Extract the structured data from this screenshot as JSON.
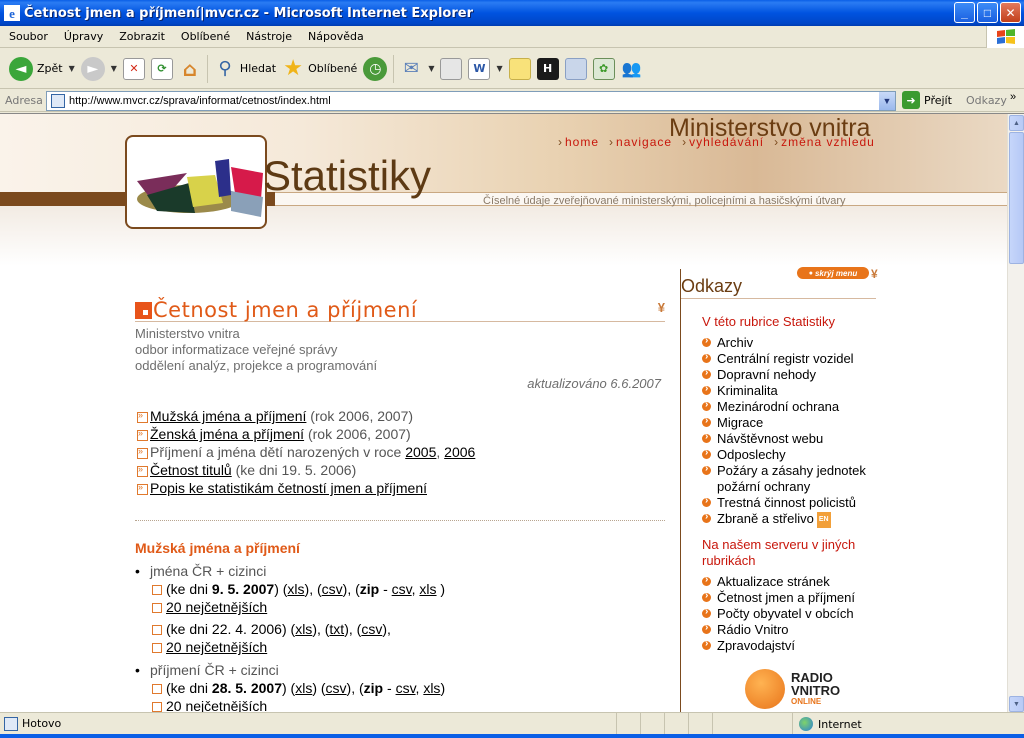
{
  "window": {
    "title": "Četnost jmen a příjmení|mvcr.cz - Microsoft Internet Explorer",
    "minimize": "_",
    "maximize": "□",
    "close": "✕"
  },
  "menu": [
    "Soubor",
    "Úpravy",
    "Zobrazit",
    "Oblíbené",
    "Nástroje",
    "Nápověda"
  ],
  "toolbar": {
    "back_label": "Zpět",
    "search_label": "Hledat",
    "favorites_label": "Oblíbené"
  },
  "address": {
    "label": "Adresa",
    "url": "http://www.mvcr.cz/sprava/informat/cetnost/index.html",
    "go_label": "Přejít",
    "links_label": "Odkazy",
    "more": "»"
  },
  "banner": {
    "ministry": "Ministerstvo vnitra",
    "site_title": "Statistiky",
    "subtitle": "Číselné údaje zveřejňované ministerskými, policejními a hasičskými útvary",
    "nav": [
      "home",
      "navigace",
      "vyhledávání",
      "změna vzhledu"
    ]
  },
  "main": {
    "title": "Četnost jmen a příjmení",
    "org_lines": [
      "Ministerstvo vnitra",
      "odbor informatizace veřejné správy",
      "oddělení analýz, projekce a programování"
    ],
    "updated": "aktualizováno 6.6.2007",
    "toc": {
      "item1_link": "Mužská jména a příjmení",
      "item1_rest": " (rok 2006, 2007)",
      "item2_link": "Ženská jména a příjmení",
      "item2_rest": " (rok 2006, 2007)",
      "item3_text": "Příjmení a jména dětí narozených v roce ",
      "item3_link1": "2005",
      "item3_sep": ", ",
      "item3_link2": "2006",
      "item4_link": "Četnost titulů",
      "item4_rest": " (ke dni 19. 5. 2006)",
      "item5_link": "Popis ke statistikám četností jmen a příjmení"
    },
    "section_title": "Mužská jména a příjmení",
    "names": {
      "label": "jména ČR + cizinci",
      "a_prefix": "(ke dni ",
      "a_date": "9. 5. 2007",
      "a_mid1": ") (",
      "a_xls": "xls",
      "a_mid2": "), (",
      "a_csv": "csv",
      "a_mid3": "), (",
      "a_zip": "zip",
      "a_dash": " - ",
      "a_zcsv": "csv",
      "a_comma": ", ",
      "a_zxls": "xls",
      "a_end": " )",
      "top20": "20 nejčetnějších",
      "b_prefix": "(ke dni 22. 4. 2006) (",
      "b_xls": "xls",
      "b_mid1": "), (",
      "b_txt": "txt",
      "b_mid2": "), (",
      "b_csv": "csv",
      "b_end": "),",
      "top20b": "20 nejčetnějších"
    },
    "surnames": {
      "label": "příjmení ČR + cizinci",
      "a_prefix": "(ke dni ",
      "a_date": "28. 5. 2007",
      "a_mid1": ") (",
      "a_xls": "xls",
      "a_mid2": ") (",
      "a_csv": "csv",
      "a_mid3": "), (",
      "a_zip": "zip",
      "a_dash": " - ",
      "a_zcsv": "csv",
      "a_comma": ", ",
      "a_zxls": "xls",
      "a_end": ")",
      "top20": "20 nejčetnějších"
    }
  },
  "sidebar": {
    "hide_menu": "skrýj menu",
    "title": "Odkazy",
    "section1": "V této rubrice Statistiky",
    "items1": [
      "Archiv",
      "Centrální registr vozidel",
      "Dopravní nehody",
      "Kriminalita",
      "Mezinárodní ochrana",
      "Migrace",
      "Návštěvnost webu",
      "Odposlechy",
      "Požáry a zásahy jednotek požární ochrany",
      "Trestná činnost policistů",
      "Zbraně a střelivo"
    ],
    "en_badge": "EN",
    "section2": "Na našem serveru v jiných rubrikách",
    "items2": [
      "Aktualizace stránek",
      "Četnost jmen a příjmení",
      "Počty obyvatel v obcích",
      "Rádio Vnitro",
      "Zpravodajství"
    ],
    "radio_line1": "RADIO",
    "radio_line2": "VNITRO",
    "radio_line3": "ONLINE"
  },
  "status": {
    "text": "Hotovo",
    "zone": "Internet"
  },
  "colors": {
    "accent_orange": "#e05a18",
    "link_red": "#c8170c",
    "brown": "#7b4a1e",
    "xp_blue": "#0053e0"
  }
}
